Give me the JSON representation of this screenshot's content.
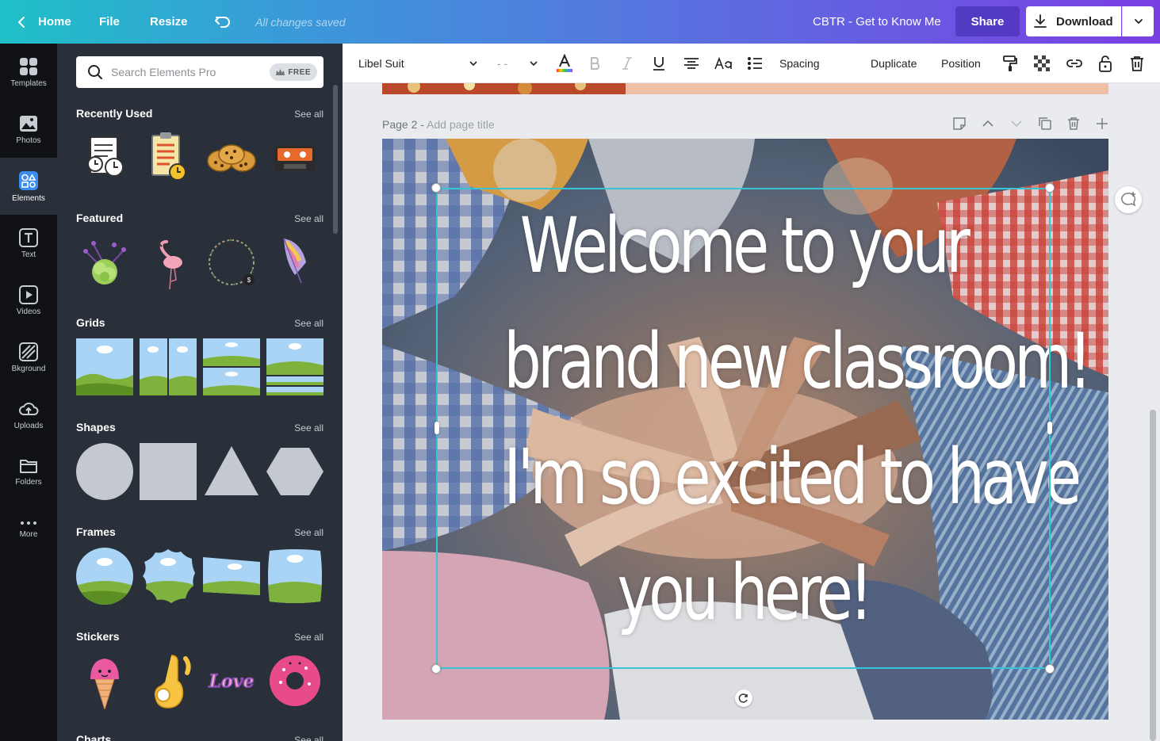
{
  "topbar": {
    "home": "Home",
    "file": "File",
    "resize": "Resize",
    "saved": "All changes saved",
    "doc_title": "CBTR - Get to Know Me",
    "share": "Share",
    "download": "Download"
  },
  "rail": {
    "items": [
      {
        "label": "Templates",
        "icon": "templates-icon"
      },
      {
        "label": "Photos",
        "icon": "photos-icon"
      },
      {
        "label": "Elements",
        "icon": "elements-icon"
      },
      {
        "label": "Text",
        "icon": "text-icon"
      },
      {
        "label": "Videos",
        "icon": "videos-icon"
      },
      {
        "label": "Bkground",
        "icon": "background-icon"
      },
      {
        "label": "Uploads",
        "icon": "uploads-icon"
      },
      {
        "label": "Folders",
        "icon": "folders-icon"
      },
      {
        "label": "More",
        "icon": "more-icon"
      }
    ],
    "active": "Elements"
  },
  "panel": {
    "search_placeholder": "Search Elements Pro",
    "free_badge": "FREE",
    "see_all": "See all",
    "sections": [
      {
        "title": "Recently Used"
      },
      {
        "title": "Featured"
      },
      {
        "title": "Grids"
      },
      {
        "title": "Shapes"
      },
      {
        "title": "Frames"
      },
      {
        "title": "Stickers"
      },
      {
        "title": "Charts"
      }
    ],
    "sticker_text": "Love"
  },
  "toolbar": {
    "font": "Libel Suit",
    "font_size": "- -",
    "spacing": "Spacing",
    "duplicate": "Duplicate",
    "position": "Position"
  },
  "canvas": {
    "page_label": "Page 2 - ",
    "page_title_placeholder": "Add page title",
    "headline_lines": [
      "Welcome to your",
      "brand new classroom!",
      "I'm so excited to have",
      "you here!"
    ]
  },
  "colors": {
    "selection": "#35c5d4",
    "panel_bg": "#293039",
    "rail_bg": "#0f1115"
  }
}
